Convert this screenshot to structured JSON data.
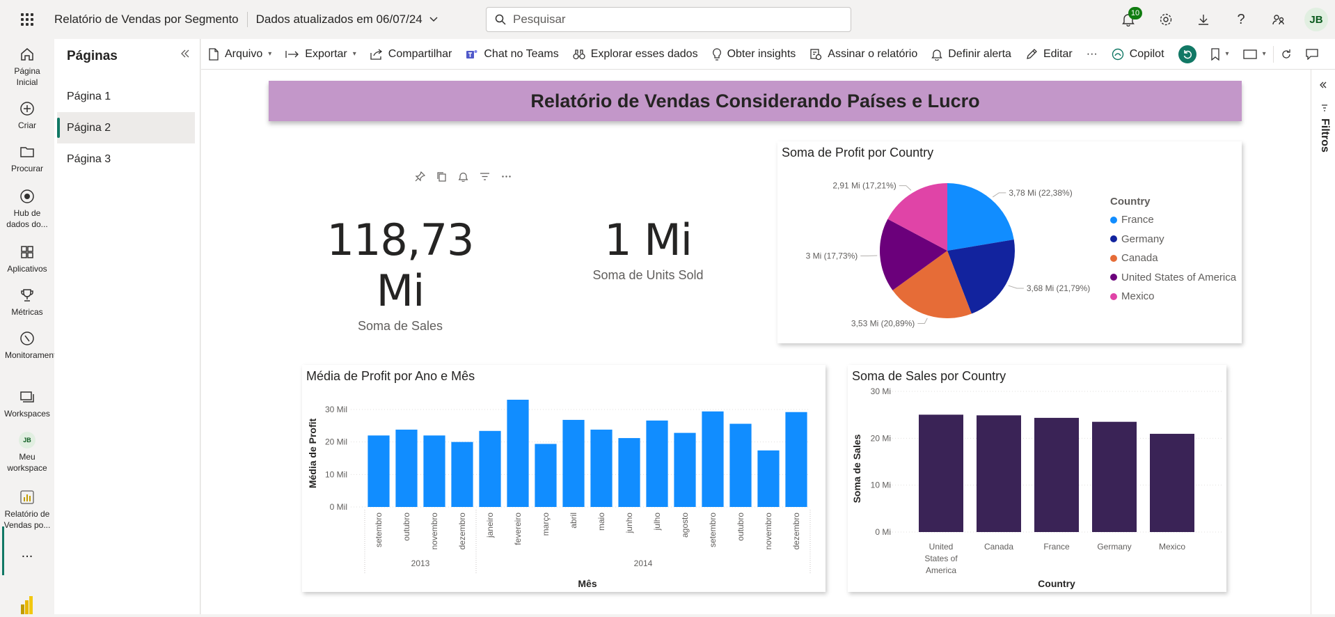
{
  "topbar": {
    "report_title": "Relatório de Vendas por Segmento",
    "updated": "Dados atualizados em 06/07/24",
    "search_placeholder": "Pesquisar",
    "notifications_count": "10",
    "avatar": "JB"
  },
  "leftnav": {
    "items": [
      {
        "label": "Página Inicial",
        "icon": "home-icon"
      },
      {
        "label": "Criar",
        "icon": "create-icon"
      },
      {
        "label": "Procurar",
        "icon": "folder-icon"
      },
      {
        "label": "Hub de dados do...",
        "icon": "data-hub-icon"
      },
      {
        "label": "Aplicativos",
        "icon": "apps-icon"
      },
      {
        "label": "Métricas",
        "icon": "trophy-icon"
      },
      {
        "label": "Monitoramento",
        "icon": "monitor-icon"
      },
      {
        "label": "Workspaces",
        "icon": "workspaces-icon"
      },
      {
        "label": "Meu workspace",
        "icon": "avatar"
      },
      {
        "label": "Relatório de Vendas po...",
        "icon": "report-icon"
      }
    ],
    "workspace_avatar": "JB",
    "more": "..."
  },
  "pages": {
    "title": "Páginas",
    "items": [
      "Página 1",
      "Página 2",
      "Página 3"
    ],
    "active": "Página 2"
  },
  "toolbar": {
    "arquivo": "Arquivo",
    "exportar": "Exportar",
    "compartilhar": "Compartilhar",
    "teams": "Chat no Teams",
    "explorar": "Explorar esses dados",
    "insights": "Obter insights",
    "assinar": "Assinar o relatório",
    "alerta": "Definir alerta",
    "editar": "Editar",
    "more": "···",
    "copilot": "Copilot"
  },
  "filters": {
    "label": "Filtros"
  },
  "report": {
    "banner_title": "Relatório de Vendas Considerando Países e Lucro",
    "kpi_sales": {
      "value": "118,73 Mi",
      "label": "Soma de  Sales"
    },
    "kpi_units": {
      "value": "1 Mi",
      "label": "Soma de Units Sold"
    }
  },
  "chart_data": [
    {
      "type": "pie",
      "title": "Soma de Profit por Country",
      "legend_title": "Country",
      "legend_position": "right",
      "categories": [
        "France",
        "Germany",
        "Canada",
        "United States of America",
        "Mexico"
      ],
      "values": [
        3.78,
        3.68,
        3.53,
        3.0,
        2.91
      ],
      "labels": [
        "3,78 Mi (22,38%)",
        "3,68 Mi (21,79%)",
        "3,53 Mi (20,89%)",
        "3 Mi (17,73%)",
        "2,91 Mi (17,21%)"
      ],
      "colors": [
        "#118dff",
        "#12239e",
        "#e66c37",
        "#6b007b",
        "#e044a7"
      ]
    },
    {
      "type": "bar",
      "title": "Média de Profit por Ano e Mês",
      "xlabel": "Mês",
      "ylabel": "Média de Profit",
      "yticks": [
        "0 Mil",
        "10 Mil",
        "20 Mil",
        "30 Mil"
      ],
      "ylim": [
        0,
        33
      ],
      "categories": [
        "setembro",
        "outubro",
        "novembro",
        "dezembro",
        "janeiro",
        "fevereiro",
        "março",
        "abril",
        "maio",
        "junho",
        "julho",
        "agosto",
        "setembro",
        "outubro",
        "novembro",
        "dezembro"
      ],
      "groups": [
        {
          "label": "2013",
          "count": 4
        },
        {
          "label": "2014",
          "count": 12
        }
      ],
      "values": [
        22,
        23.8,
        22,
        20,
        23.4,
        33,
        19.4,
        26.8,
        23.8,
        21.2,
        26.6,
        22.8,
        29.4,
        25.6,
        17.4,
        29.2
      ],
      "color": "#118dff"
    },
    {
      "type": "bar",
      "title": "Soma de Sales por Country",
      "xlabel": "Country",
      "ylabel": "Soma de Sales",
      "yticks": [
        "0 Mi",
        "10 Mi",
        "20 Mi",
        "30 Mi"
      ],
      "ylim": [
        0,
        30
      ],
      "categories": [
        "United States of America",
        "Canada",
        "France",
        "Germany",
        "Mexico"
      ],
      "values": [
        25.03,
        24.89,
        24.35,
        23.51,
        20.95
      ],
      "color": "#3a2356"
    }
  ]
}
